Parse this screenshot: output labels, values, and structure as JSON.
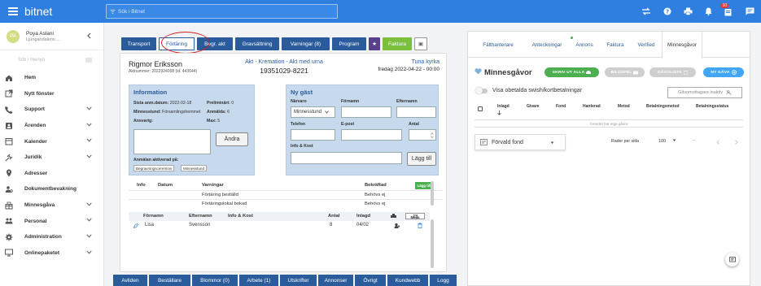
{
  "topbar": {
    "brand": "bitnet",
    "search_placeholder": "Sök i Bitnet",
    "notification_count": "10"
  },
  "sidebar": {
    "user_initials": "PA",
    "user_name": "Poya Aslani",
    "user_org": "Ljungandalens ...",
    "search_placeholder": "Sök i menyn",
    "items": [
      {
        "label": "Hem",
        "icon": "home-icon",
        "has_chevron": false
      },
      {
        "label": "Nytt fönster",
        "icon": "new-window-icon",
        "has_chevron": false
      },
      {
        "label": "Support",
        "icon": "phone-icon",
        "has_chevron": true
      },
      {
        "label": "Ärenden",
        "icon": "case-icon",
        "has_chevron": true
      },
      {
        "label": "Kalender",
        "icon": "calendar-icon",
        "has_chevron": true
      },
      {
        "label": "Juridik",
        "icon": "gavel-icon",
        "has_chevron": true
      },
      {
        "label": "Adresser",
        "icon": "location-icon",
        "has_chevron": false
      },
      {
        "label": "Dokumentbevakning",
        "icon": "document-watch-icon",
        "has_chevron": false
      },
      {
        "label": "Minnesgåva",
        "icon": "gift-icon",
        "has_chevron": true
      },
      {
        "label": "Personal",
        "icon": "people-icon",
        "has_chevron": true
      },
      {
        "label": "Administration",
        "icon": "gear-icon",
        "has_chevron": true
      },
      {
        "label": "Onlinepaketet",
        "icon": "monitor-icon",
        "has_chevron": true
      }
    ]
  },
  "tabs": [
    "Transport",
    "Förtäring",
    "Begr. akt",
    "Gravsättning",
    "Varningar (8)",
    "Program",
    "★",
    "Faktura",
    "▣"
  ],
  "case": {
    "name": "Rigmor Eriksson",
    "aktnummer": "Aktnummer: 2022924008 (id: 443644)",
    "title": "Akt - Kremation - Akt med urna",
    "personnummer": "19351029-8221",
    "church": "Tuna kyrka",
    "date": "fredag 2022-04-22 - 00:00"
  },
  "info": {
    "title": "Information",
    "sista_label": "Sista anm.datum:",
    "sista_value": "2022-02-18",
    "prel_label": "Preliminärt:",
    "prel_value": "0",
    "minnes_label": "Minnesstund:",
    "minnes_value": "Församlingshemmet",
    "anmalda_label": "Anmälda:",
    "anmalda_value": "6",
    "ansvarig_label": "Ansvarig:",
    "max_label": "Max:",
    "max_value": "5",
    "andra_button": "Ändra",
    "aktiverad_label": "Anmälan aktiverad på:",
    "chips": [
      "Begravningsceremoni",
      "Minnesstund"
    ]
  },
  "guest": {
    "title": "Ny gäst",
    "narvaro_label": "Närvaro",
    "narvaro_value": "Minnesstund",
    "fornamn_label": "Förnamn",
    "efternamn_label": "Efternamn",
    "telefon_label": "Telefon",
    "epost_label": "E-post",
    "antal_label": "Antal",
    "info_label": "Info & Kost",
    "lagg_till": "Lägg till"
  },
  "orders": {
    "headers": {
      "info": "Info",
      "datum": "Datum",
      "varningar": "Varningar",
      "bekraftad": "Bekräftad",
      "lagg_till": "Lägg till"
    },
    "rows": [
      {
        "varning": "Förtäring beställd",
        "bekraftad": "Behövs ej"
      },
      {
        "varning": "Förtäringslokal bokad",
        "bekraftad": "Behövs ej"
      }
    ]
  },
  "guests": {
    "headers": {
      "fornamn": "Förnamn",
      "efternamn": "Efternamn",
      "info": "Info & Kost",
      "antal": "Antal",
      "inlagd": "Inlagd",
      "mejla": "Mejla"
    },
    "rows": [
      {
        "fornamn": "Lisa",
        "efternamn": "Svensson",
        "info": "",
        "antal": "8",
        "inlagd": "04/02"
      }
    ]
  },
  "bottom_tabs": [
    "Avliden",
    "Beställare",
    "Blommor (0)",
    "Arbete (1)",
    "Utskrifter",
    "Annonser",
    "Övrigt",
    "Kundwebb",
    "Logg"
  ],
  "right": {
    "tabs": [
      "Fälthanterare",
      "Anteckningar",
      "Annons",
      "Faktura",
      "Verified",
      "Minnesgåvor"
    ],
    "title": "Minnesgåvor",
    "skriv_ut": "SKRIV UT ALLA",
    "bildspel": "BILDSPEL",
    "gavolista": "GÅVOLISTA",
    "ny_gava": "NY GÅVA",
    "toggle_label": "Visa obetalda swish/kortbetalningar",
    "inaktiv_btn": "Gåvomottagare inaktiv",
    "columns": [
      "Inlagd",
      "Givare",
      "Fond",
      "Hanterad",
      "Metod",
      "Betalningsmetod",
      "Betalningsstatus"
    ],
    "empty_text": "Ärendet har inga gåvor",
    "fond_select": "Förvald fond",
    "rows_per_page_label": "Rader per sida",
    "rows_per_page_value": "100",
    "pagination_range": "–",
    "colors": {
      "green": "#4caf50",
      "blue": "#42a5f5",
      "grey": "#cfcfcf"
    }
  }
}
